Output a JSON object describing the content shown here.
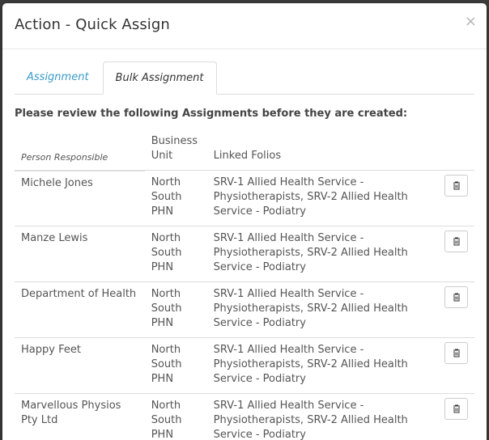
{
  "modal": {
    "title": "Action - Quick Assign",
    "close_label": "×"
  },
  "tabs": [
    {
      "label": "Assignment",
      "active": false
    },
    {
      "label": "Bulk Assignment",
      "active": true
    }
  ],
  "review_text": "Please review the following Assignments before they are created:",
  "table": {
    "headers": {
      "person": "Person Responsible",
      "business_unit": "Business Unit",
      "linked_folios": "Linked Folios"
    },
    "rows": [
      {
        "person": "Michele Jones",
        "business_unit": "North South PHN",
        "linked_folios": "SRV-1 Allied Health Service - Physiotherapists, SRV-2 Allied Health Service - Podiatry"
      },
      {
        "person": "Manze Lewis",
        "business_unit": "North South PHN",
        "linked_folios": "SRV-1 Allied Health Service - Physiotherapists, SRV-2 Allied Health Service - Podiatry"
      },
      {
        "person": "Department of Health",
        "business_unit": "North South PHN",
        "linked_folios": "SRV-1 Allied Health Service - Physiotherapists, SRV-2 Allied Health Service - Podiatry"
      },
      {
        "person": "Happy Feet",
        "business_unit": "North South PHN",
        "linked_folios": "SRV-1 Allied Health Service - Physiotherapists, SRV-2 Allied Health Service - Podiatry"
      },
      {
        "person": "Marvellous Physios Pty Ltd",
        "business_unit": "North South PHN",
        "linked_folios": "SRV-1 Allied Health Service - Physiotherapists, SRV-2 Allied Health Service - Podiatry"
      }
    ]
  },
  "icons": {
    "delete": "trash-icon",
    "close": "close-icon"
  },
  "colors": {
    "tab_link": "#3a9bc7",
    "backdrop": "#3c3c3c"
  }
}
